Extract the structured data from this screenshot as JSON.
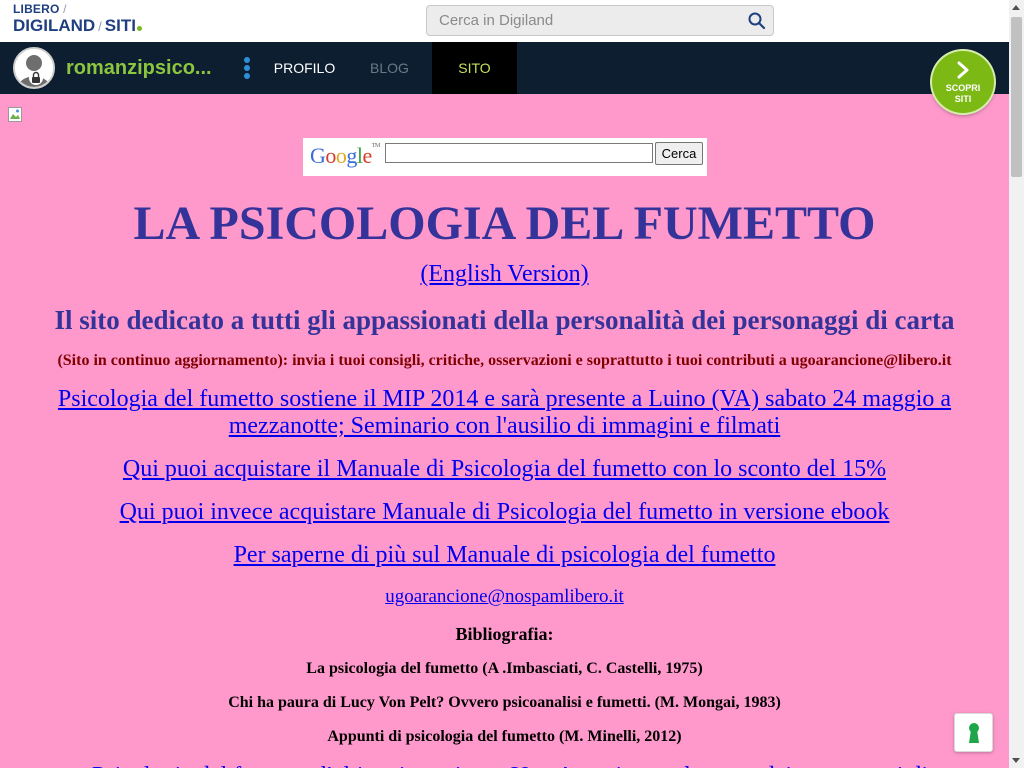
{
  "brand": {
    "line1_libero": "LIBERO",
    "line1_sep": "/",
    "line2_digiland": "DIGILAND",
    "line2_sep": "/",
    "line2_siti": "SITI"
  },
  "search": {
    "placeholder": "Cerca in Digiland",
    "value": "",
    "icon": "search-icon"
  },
  "navbar": {
    "site_name": "romanzipsico...",
    "menu_icon": "kebab-menu-icon",
    "items": [
      {
        "label": "PROFILO",
        "active": false
      },
      {
        "label": "BLOG",
        "active": false
      },
      {
        "label": "SITO",
        "active": true
      }
    ],
    "avatar_icon": "locked-user-avatar-icon"
  },
  "scopri": {
    "line1": "SCOPRI",
    "line2": "SITI",
    "icon": "chevron-right-icon"
  },
  "page": {
    "google_logo": {
      "G": "G",
      "o1": "o",
      "o2": "o",
      "g": "g",
      "l": "l",
      "e": "e",
      "tm": "TM"
    },
    "google_search_value": "",
    "google_button": "Cerca",
    "title": "LA PSICOLOGIA DEL FUMETTO",
    "english_link": "(English Version)",
    "subtitle": "Il sito dedicato a tutti gli appassionati della personalità dei personaggi di carta",
    "note": "(Sito in continuo aggiornamento): invia i tuoi consigli, critiche, osservazioni e soprattutto i tuoi contributi a ugoarancione@libero.it",
    "links": [
      "Psicologia del fumetto sostiene il MIP 2014 e sarà presente a Luino (VA) sabato 24 maggio a mezzanotte; Seminario con l'ausilio di immagini e filmati",
      "Qui puoi acquistare il Manuale di Psicologia del fumetto con lo sconto del 15%",
      "Qui puoi invece acquistare Manuale di Psicologia del fumetto in versione ebook",
      "Per saperne di più sul Manuale di psicologia del fumetto"
    ],
    "email_link": "ugoarancione@nospamlibero.it",
    "bibliography_heading": "Bibliografia:",
    "bibliography": [
      "La psicologia del fumetto (A .Imbasciati, C. Castelli, 1975)",
      "Chi ha paura di Lucy Von Pelt? Ovvero psicoanalisi e fumetti. (M. Mongai, 1983)",
      "Appunti di psicologia del fumetto (M. Minelli, 2012)"
    ],
    "cutoff_text": "Psicologia del fumetto: l'ultima intervista a Ugo Arancione sul potere dei personaggi di fumetti e del loro effetto di vita"
  },
  "cookie_button": {
    "icon": "privacy-keyhole-icon"
  },
  "colors": {
    "page_bg": "#ff99cc",
    "navbar_bg": "#0d1e30",
    "title_color": "#333399",
    "accent_green": "#7cb915",
    "site_name_color": "#8cc63f",
    "link_color": "#0000ee",
    "note_color": "#800000"
  }
}
